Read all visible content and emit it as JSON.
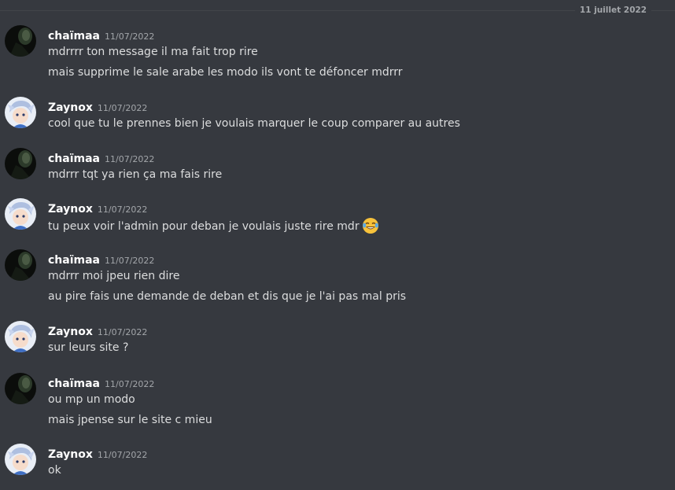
{
  "date_divider": "11 juillet 2022",
  "messages": [
    {
      "author": "chaïmaa",
      "timestamp": "11/07/2022",
      "lines": [
        "mdrrrr ton message il ma fait trop rire",
        "mais supprime le sale arabe les modo ils vont te défoncer mdrrr"
      ]
    },
    {
      "author": "Zaynox",
      "timestamp": "11/07/2022",
      "lines": [
        "cool que tu le prennes bien je voulais marquer le coup comparer au autres"
      ]
    },
    {
      "author": "chaïmaa",
      "timestamp": "11/07/2022",
      "lines": [
        "mdrrr tqt ya rien ça ma fais rire"
      ]
    },
    {
      "author": "Zaynox",
      "timestamp": "11/07/2022",
      "lines": [
        "tu peux voir l'admin pour deban je voulais juste rire mdr"
      ],
      "emoji": "joy-emoji"
    },
    {
      "author": "chaïmaa",
      "timestamp": "11/07/2022",
      "lines": [
        "mdrrr moi jpeu rien dire",
        "au pire fais une demande de deban et dis que je l'ai pas mal pris"
      ]
    },
    {
      "author": "Zaynox",
      "timestamp": "11/07/2022",
      "lines": [
        "sur leurs site ?"
      ]
    },
    {
      "author": "chaïmaa",
      "timestamp": "11/07/2022",
      "lines": [
        "ou mp un modo",
        "mais jpense sur le site c mieu"
      ]
    },
    {
      "author": "Zaynox",
      "timestamp": "11/07/2022",
      "lines": [
        "ok"
      ]
    }
  ]
}
